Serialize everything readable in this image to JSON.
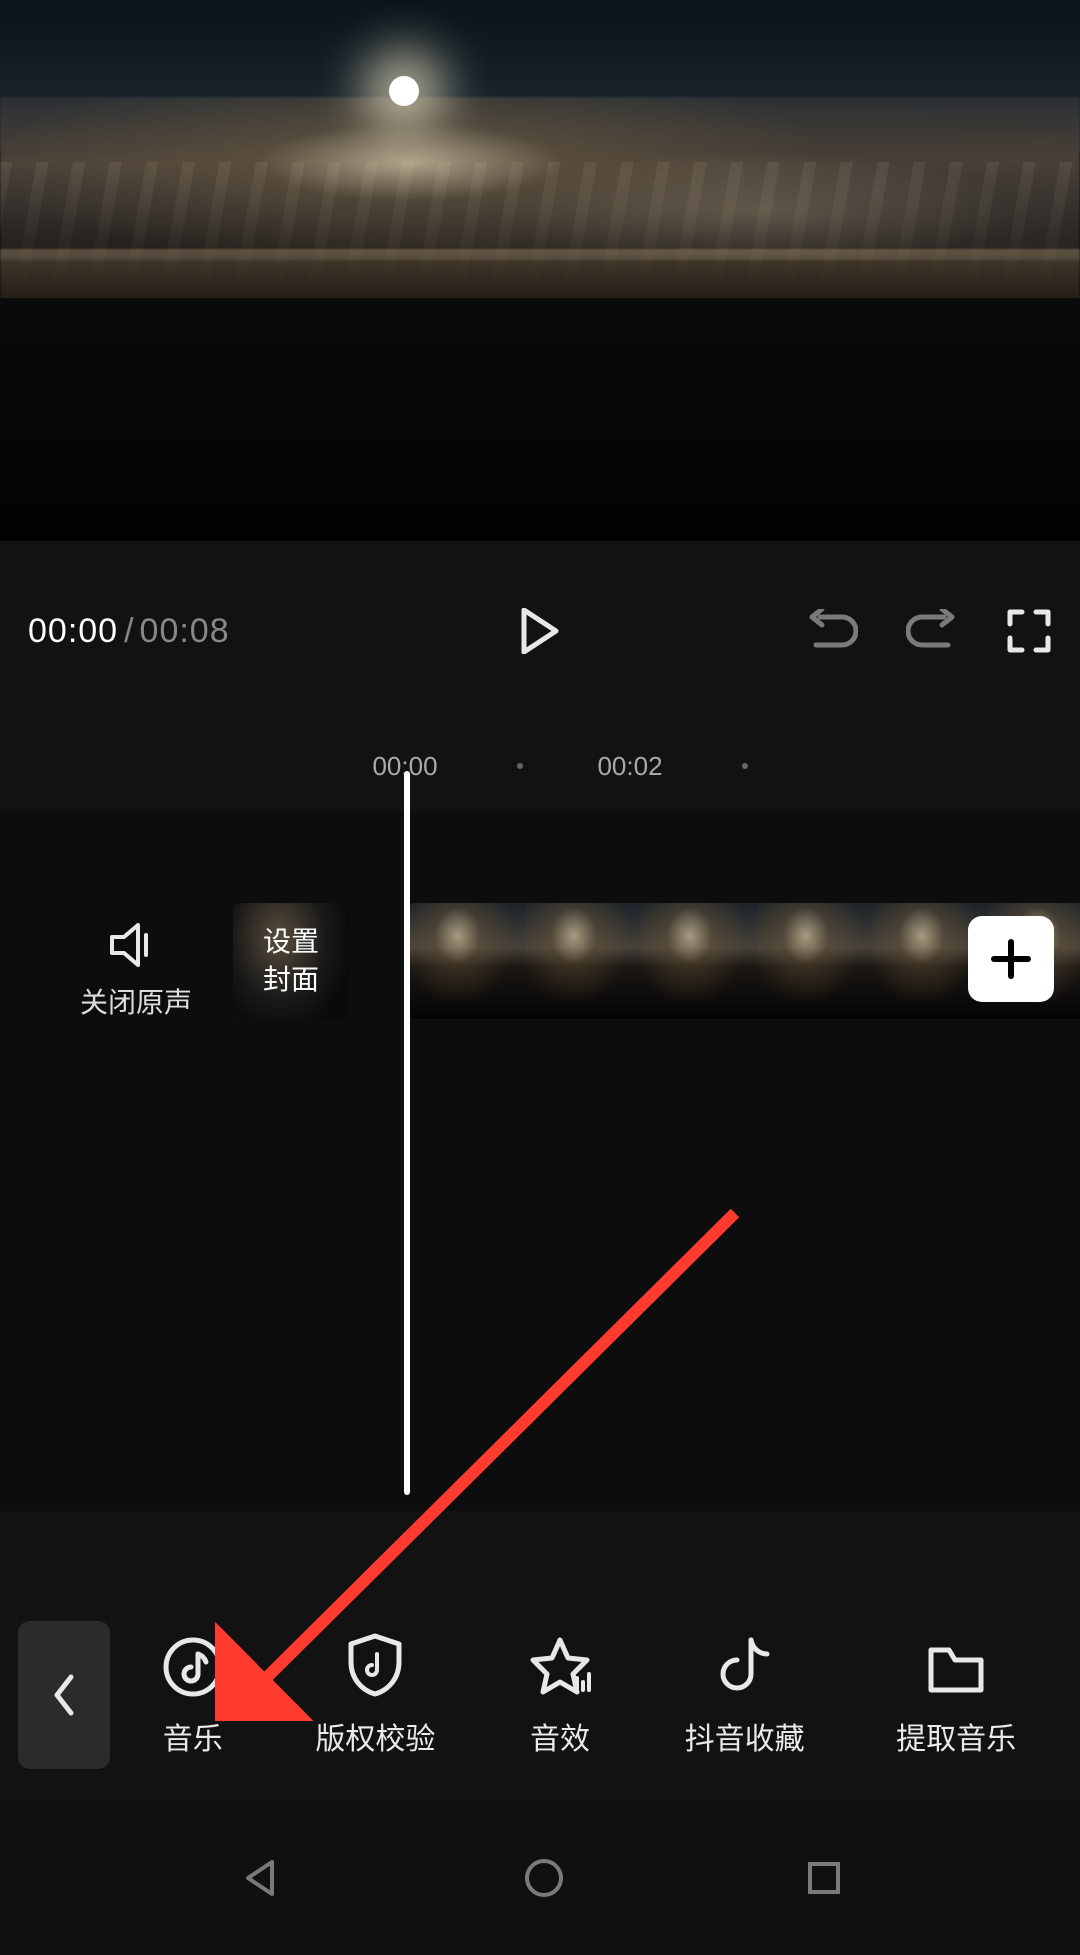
{
  "playback": {
    "current": "00:00",
    "separator": "/",
    "total": "00:08"
  },
  "ruler": {
    "mark0": "00:00",
    "mark1": "00:02"
  },
  "mute": {
    "label": "关闭原声"
  },
  "cover": {
    "label": "设置\n封面"
  },
  "toolbar": {
    "music": {
      "label": "音乐"
    },
    "copyright": {
      "label": "版权校验"
    },
    "sfx": {
      "label": "音效"
    },
    "douyinFav": {
      "label": "抖音收藏"
    },
    "extract": {
      "label": "提取音乐"
    }
  }
}
